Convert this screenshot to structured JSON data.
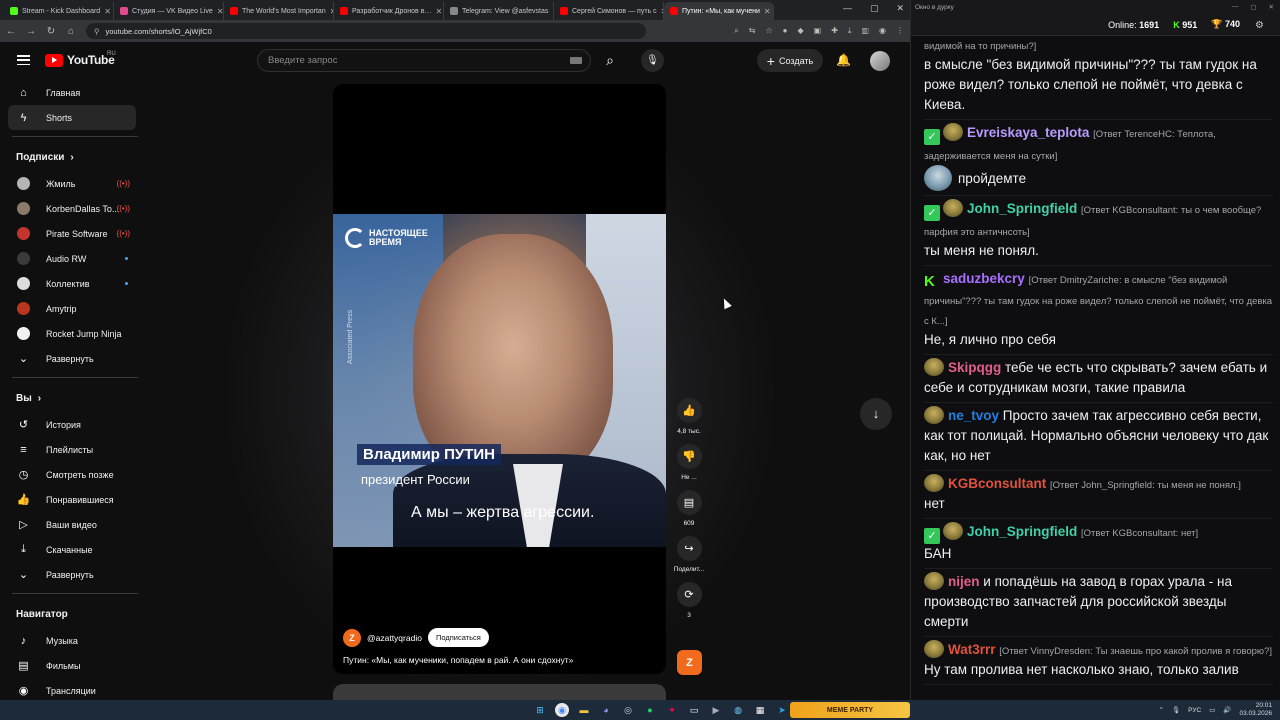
{
  "browser": {
    "tabs": [
      {
        "label": "Stream - Kick Dashboard",
        "color": "#53fc18",
        "active": false
      },
      {
        "label": "Студия — VK Видео Live",
        "color": "#e24a8d",
        "active": false
      },
      {
        "label": "The World's Most Importan",
        "color": "#ff0000",
        "active": false
      },
      {
        "label": "Разработчик Дронов в…",
        "color": "#ff0000",
        "active": false
      },
      {
        "label": "Telegram: View @asfevstas",
        "color": "#888888",
        "active": false
      },
      {
        "label": "Сергей Симонов — путь с",
        "color": "#ff0000",
        "active": false
      },
      {
        "label": "Путин: «Мы, как мучени",
        "color": "#ff0000",
        "active": true
      }
    ],
    "url": "youtube.com/shorts/lO_AjWjfC0"
  },
  "youtube": {
    "region": "RU",
    "logo_text": "YouTube",
    "search_placeholder": "Введите запрос",
    "create_label": "Создать",
    "nav": [
      {
        "label": "Главная",
        "icon": "home-icon"
      },
      {
        "label": "Shorts",
        "icon": "shorts-icon",
        "active": true
      }
    ],
    "subscriptions_heading": "Подписки",
    "subscriptions": [
      {
        "name": "Жмиль",
        "color": "#b5b5b5",
        "status": "live"
      },
      {
        "name": "KorbenDallas To...",
        "color": "#8c7b6b",
        "status": "live"
      },
      {
        "name": "Pirate Software",
        "color": "#c2352e",
        "status": "live"
      },
      {
        "name": "Audio RW",
        "color": "#3a3a3a",
        "status": "new"
      },
      {
        "name": "Коллектив",
        "color": "#dddddd",
        "status": "new"
      },
      {
        "name": "Amytrip",
        "color": "#b8371c",
        "status": ""
      },
      {
        "name": "Rocket Jump Ninja",
        "color": "#f1f1f1",
        "status": ""
      }
    ],
    "expand_label": "Развернуть",
    "you_heading": "Вы",
    "you_items": [
      {
        "label": "История",
        "icon": "history-icon"
      },
      {
        "label": "Плейлисты",
        "icon": "playlists-icon"
      },
      {
        "label": "Смотреть позже",
        "icon": "clock-icon"
      },
      {
        "label": "Понравившиеся",
        "icon": "thumb-up-icon"
      },
      {
        "label": "Ваши видео",
        "icon": "play-icon"
      },
      {
        "label": "Скачанные",
        "icon": "download-icon"
      },
      {
        "label": "Развернуть",
        "icon": "chevron-down-icon"
      }
    ],
    "navigator_heading": "Навигатор",
    "navigator_items": [
      {
        "label": "Музыка",
        "icon": "music-icon"
      },
      {
        "label": "Фильмы",
        "icon": "film-icon"
      },
      {
        "label": "Трансляции",
        "icon": "live-icon"
      }
    ]
  },
  "short": {
    "brand": "НАСТОЯЩЕЕ ВРЕМЯ",
    "credit": "Associated Press",
    "name_plate": "Владимир ПУТИН",
    "title_plate": "президент России",
    "subtitle": "А мы – жертва агрессии.",
    "channel": "@azattyqradio",
    "subscribe_label": "Подписаться",
    "title": "Путин: «Мы, как мученики, попадем в рай. А они сдохнут»",
    "likes": "4,8 тыс.",
    "dislike_label": "Не ...",
    "comments": "609",
    "share_label": "Поделит...",
    "remix": "3"
  },
  "chat": {
    "window_title": "Окно в дурку",
    "online_label": "Online:",
    "online": "1691",
    "followers": "951",
    "coins": "740",
    "messages": [
      {
        "badges": [],
        "user": "",
        "color": "#efeff1",
        "reply": "видимой на то причины?]",
        "text": "в смысле \"без видимой причины\"??? ты там гудок на роже видел? только слепой не поймёт, что девка с Киева."
      },
      {
        "badges": [
          "check",
          "emote"
        ],
        "user": "Evreiskaya_teplota",
        "color": "#b89bff",
        "reply": "[Ответ TerenceHC: Теплота, задерживается меня на сутки]",
        "text": "",
        "emote_text": "пройдемте"
      },
      {
        "badges": [
          "check",
          "emote"
        ],
        "user": "John_Springfield",
        "color": "#3fd1a8",
        "reply": "[Ответ KGBconsultant: ты о чем вообще? парфия это античнсоть]",
        "text": "ты меня не понял."
      },
      {
        "badges": [
          "k"
        ],
        "user": "saduzbekcry",
        "color": "#a970ff",
        "reply": "[Ответ DmitryZariche: в смысле \"без видимой причины\"??? ты там гудок на роже видел? только слепой не поймёт, что девка с К...]",
        "text": "Не, я лично про себя"
      },
      {
        "badges": [
          "emote"
        ],
        "user": "Skipqgg",
        "color": "#e35e8b",
        "reply": "",
        "inline": "тебе че есть что скрывать? зачем ебать и себе и сотрудникам мозги, такие правила"
      },
      {
        "badges": [
          "emote"
        ],
        "user": "ne_tvoy",
        "color": "#1f7fe0",
        "reply": "",
        "inline": "Просто зачем так агрессивно себя вести, как тот полицай. Нормально объясни человеку что дак как, но нет"
      },
      {
        "badges": [
          "emote"
        ],
        "user": "KGBconsultant",
        "color": "#e0523a",
        "reply": "[Ответ John_Springfield: ты меня не понял.]",
        "text": "нет"
      },
      {
        "badges": [
          "check",
          "emote"
        ],
        "user": "John_Springfield",
        "color": "#3fd1a8",
        "reply": "[Ответ KGBconsultant: нет]",
        "text": "БАН"
      },
      {
        "badges": [
          "emote"
        ],
        "user": "nijen",
        "color": "#e35e8b",
        "reply": "",
        "inline": "и попадёшь на завод  в горах урала - на производство запчастей для российской звезды смерти"
      },
      {
        "badges": [
          "emote"
        ],
        "user": "Wat3rrr",
        "color": "#e0523a",
        "reply": "[Ответ VinnyDresden: Ты знаешь про какой пролив я говорю?]",
        "text": "Ну там пролива нет насколько знаю, только залив"
      }
    ]
  },
  "taskbar": {
    "meme_banner": "MEME PARTY",
    "lang": "РУС",
    "time": "20:01",
    "date": "03.03.2026"
  }
}
